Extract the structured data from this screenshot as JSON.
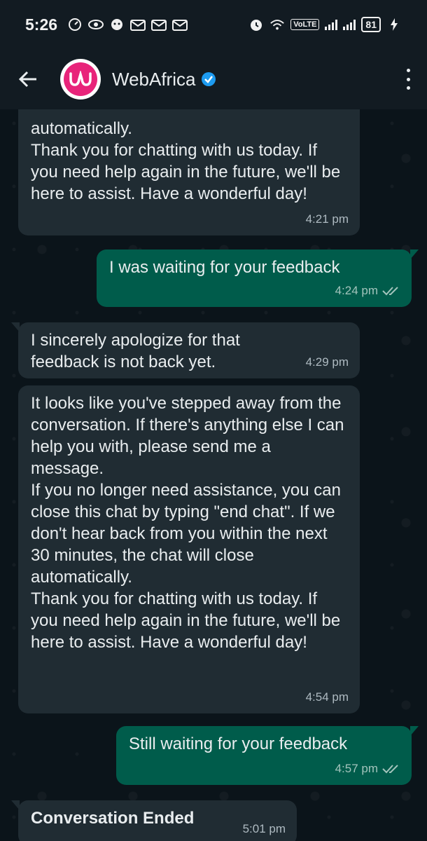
{
  "status_bar": {
    "time": "5:26",
    "volte": "VoLTE",
    "battery": "81"
  },
  "header": {
    "contact_name": "WebAfrica",
    "brand_color": "#e8247a",
    "verified_color": "#1d9bf0"
  },
  "messages": [
    {
      "direction": "incoming",
      "text": "automatically.\nThank you for chatting with us today. If you need help again in the future, we'll be here to assist. Have a wonderful day!",
      "time": "4:21 pm"
    },
    {
      "direction": "outgoing",
      "text": "I was waiting for your feedback",
      "time": "4:24 pm",
      "status": "read"
    },
    {
      "direction": "incoming",
      "text": "I sincerely apologize for that feedback is not back yet.",
      "time": "4:29 pm"
    },
    {
      "direction": "incoming",
      "text": "It looks like you've stepped away from the conversation. If there's anything else I can help you with, please send me a message.\nIf you no longer need assistance, you can close this chat by typing \"end chat\". If we don't hear back from you within the next 30 minutes, the chat will close automatically.\nThank you for chatting with us today. If you need help again in the future, we'll be here to assist. Have a wonderful day!",
      "time": "4:54 pm"
    },
    {
      "direction": "outgoing",
      "text": "Still waiting for your feedback",
      "time": "4:57 pm",
      "status": "read"
    },
    {
      "direction": "incoming",
      "text": "Conversation Ended",
      "time": "5:01 pm"
    }
  ]
}
